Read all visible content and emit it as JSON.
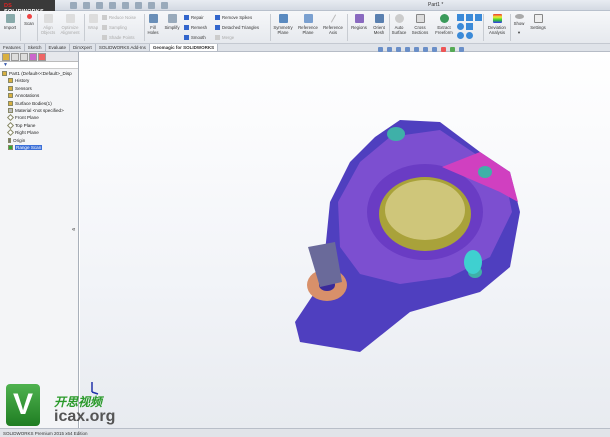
{
  "app": {
    "logo": "SOLIDWORKS",
    "logo_prefix": "DS",
    "doc_title": "Part1 *"
  },
  "ribbon": {
    "big": [
      {
        "label": "Import"
      },
      {
        "label": "Scan"
      },
      {
        "label": "Align Objects"
      },
      {
        "label": "Optimize Alignment"
      },
      {
        "label": "Wrap"
      },
      {
        "label": "Fill Holes"
      },
      {
        "label": "Simplify"
      },
      {
        "label": "Symmetry Plane"
      },
      {
        "label": "Reference Plane"
      },
      {
        "label": "Reference Axis"
      },
      {
        "label": "Regions"
      },
      {
        "label": "Orient Mesh"
      },
      {
        "label": "Auto Surface"
      },
      {
        "label": "Cross Sections"
      },
      {
        "label": "Extract Freeform"
      },
      {
        "label": "Deviation Analysis"
      },
      {
        "label": "Show"
      },
      {
        "label": "Settings"
      }
    ],
    "small": [
      {
        "label": "Reduce Noise"
      },
      {
        "label": "Sampling"
      },
      {
        "label": "Shade Points"
      },
      {
        "label": "Repair"
      },
      {
        "label": "Remesh"
      },
      {
        "label": "Smooth"
      },
      {
        "label": "Remove Spikes"
      },
      {
        "label": "Detached Triangles"
      },
      {
        "label": "Merge"
      }
    ]
  },
  "tabs": [
    {
      "label": "Features"
    },
    {
      "label": "Sketch"
    },
    {
      "label": "Evaluate"
    },
    {
      "label": "DimXpert"
    },
    {
      "label": "SOLIDWORKS Add-Ins"
    },
    {
      "label": "Geomagic for SOLIDWORKS"
    }
  ],
  "tree": [
    {
      "label": "Part1  (Default<<Default>_Disp"
    },
    {
      "label": "History"
    },
    {
      "label": "Sensors"
    },
    {
      "label": "Annotations"
    },
    {
      "label": "Surface Bodies(1)"
    },
    {
      "label": "Material <not specified>"
    },
    {
      "label": "Front Plane"
    },
    {
      "label": "Top Plane"
    },
    {
      "label": "Right Plane"
    },
    {
      "label": "Origin"
    },
    {
      "label": "Range Scan"
    }
  ],
  "status": "SOLIDWORKS Premium 2015 x64 Edition",
  "watermark": {
    "letter": "V",
    "cn": "开思视频",
    "en": "icax.org"
  }
}
